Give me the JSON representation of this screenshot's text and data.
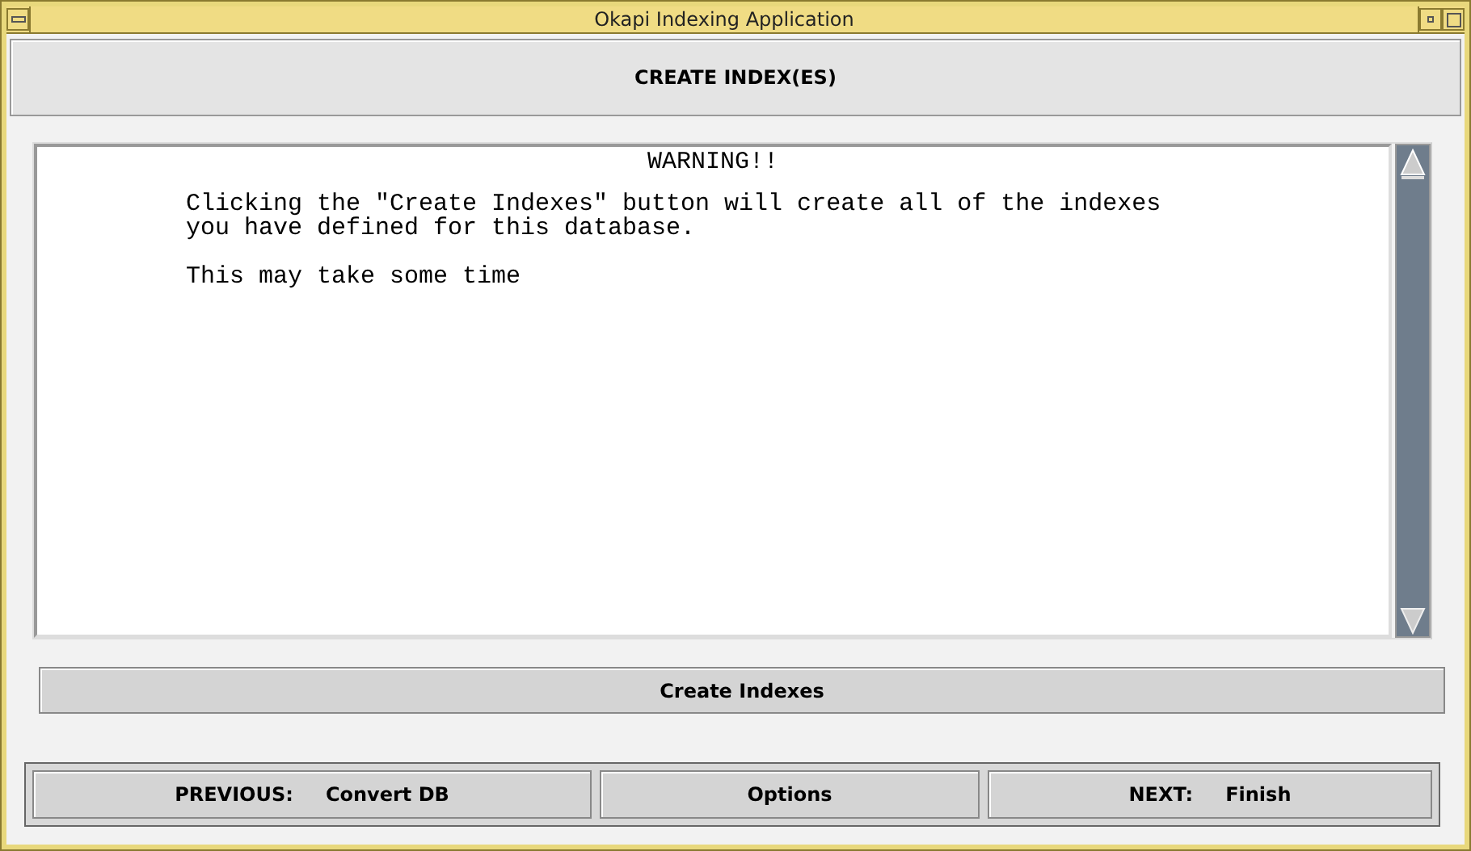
{
  "window": {
    "title": "Okapi Indexing Application"
  },
  "header": {
    "title": "CREATE INDEX(ES)"
  },
  "message": {
    "heading": "WARNING!!",
    "paragraphs": [
      "Clicking the \"Create Indexes\" button will create all of the indexes\nyou have defined for this database.",
      "This may take some time"
    ]
  },
  "action_button": {
    "label": "Create Indexes"
  },
  "nav_buttons": [
    {
      "label": "PREVIOUS:",
      "target": "Convert DB"
    },
    {
      "label": "Options"
    },
    {
      "label": "NEXT:",
      "target": "Finish"
    }
  ]
}
